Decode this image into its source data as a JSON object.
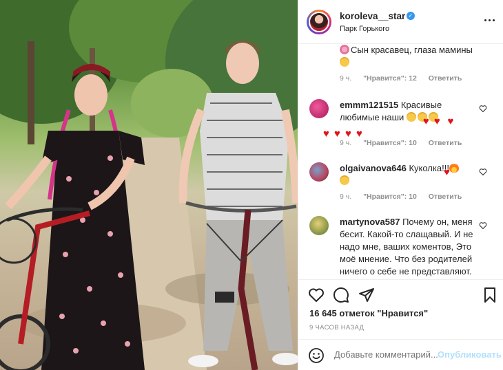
{
  "post": {
    "username": "koroleva__star",
    "location": "Парк Горького",
    "verified_icon": "verified-badge-icon",
    "photo_alt": "",
    "colors": {
      "accent": "#0095f6",
      "text": "#262626",
      "muted": "#8e8e8e",
      "post_disabled": "#b2dffc",
      "heart_red": "#e0141b"
    }
  },
  "comments": [
    {
      "username": "",
      "text": "Сын красавец, глаза мамины",
      "time": "9 ч.",
      "likes": "\"Нравится\": 12",
      "reply": "Ответить"
    },
    {
      "username": "emmm121515",
      "text": "Красивые любимые наши",
      "time": "9 ч.",
      "likes": "\"Нравится\": 10",
      "reply": "Ответить"
    },
    {
      "username": "olgaivanova646",
      "text": "Куколка!!!",
      "time": "9 ч.",
      "likes": "\"Нравится\": 10",
      "reply": "Ответить"
    },
    {
      "username": "martynova587",
      "text": "Почему он, меня бесит. Какой-то слащавый. И не надо мне, ваших коментов, Это моё мнение. Что без родителей ничего о себе не представляют. Парень ты наш"
    }
  ],
  "actions": {
    "likes_count": "16 645 отметок \"Нравится\"",
    "time_ago": "9 ЧАСОВ НАЗАД",
    "comment_placeholder": "Добавьте комментарий...",
    "post_button": "Опубликовать"
  },
  "icons": [
    "heart-icon",
    "comment-icon",
    "share-icon",
    "bookmark-icon",
    "emoji-icon",
    "more-options-icon"
  ]
}
